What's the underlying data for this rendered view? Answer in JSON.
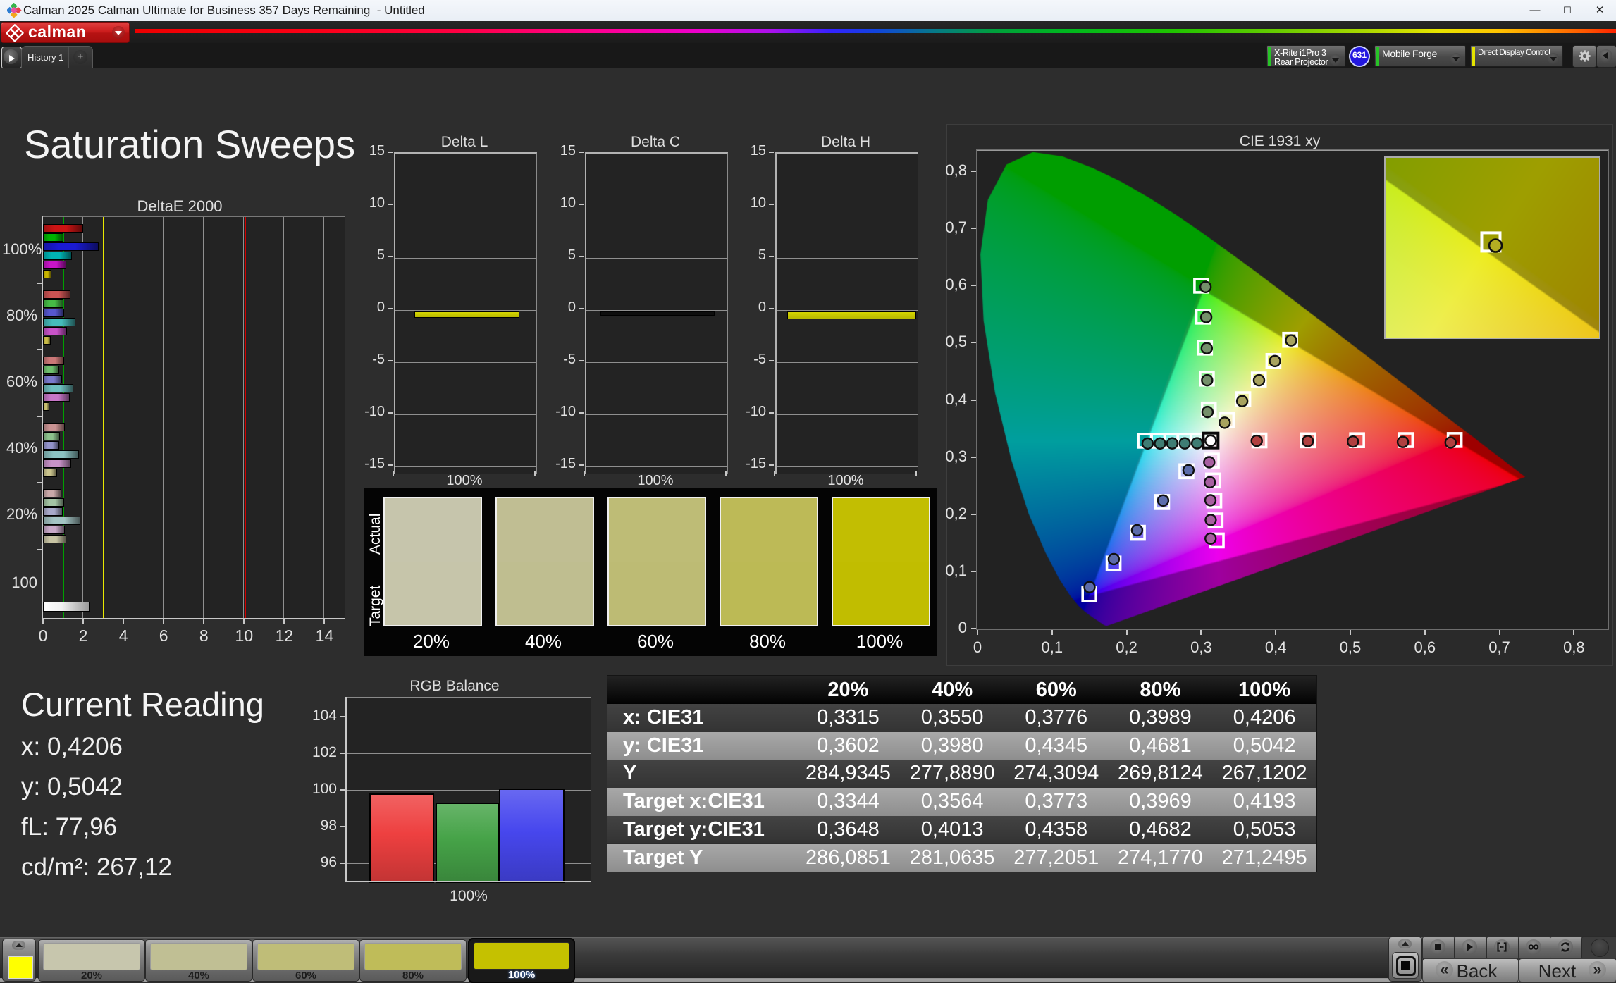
{
  "window": {
    "title": "Calman 2025 Calman Ultimate for Business 357 Days Remaining  - Untitled",
    "minimize": "—",
    "maximize": "☐",
    "close": "✕"
  },
  "logo_bar": {
    "brand": "calman",
    "brand_color": "#cc1d1d"
  },
  "tab_bar": {
    "tab": "History 1",
    "add": "+",
    "meter": {
      "line1": "X-Rite i1Pro 3",
      "line2": "Rear Projector",
      "accent": "#27c427"
    },
    "badge": "631",
    "badge_color": "#2217e0",
    "source": "Mobile Forge",
    "source_accent": "#27c427",
    "display_control": "Direct Display Control",
    "display_control_accent": "#e3e300"
  },
  "page": {
    "title": "Saturation Sweeps"
  },
  "reading": {
    "title": "Current Reading",
    "lines": [
      "x: 0,4206",
      "y: 0,5042",
      "fL: 77,96",
      "cd/m²: 267,12"
    ]
  },
  "cie": {
    "title": "CIE 1931 xy"
  },
  "chart_data": [
    {
      "id": "deltae",
      "type": "bar",
      "title": "DeltaE 2000",
      "orientation": "horizontal",
      "categories": [
        "100%",
        "80%",
        "60%",
        "40%",
        "20%",
        "100"
      ],
      "series": [
        {
          "name": "red",
          "color": "#cc1414",
          "values": [
            2.0,
            1.36,
            1.06,
            1.1,
            0.9,
            null
          ]
        },
        {
          "name": "green",
          "color": "#00b400",
          "values": [
            1.0,
            1.03,
            0.8,
            0.85,
            1.06,
            null
          ]
        },
        {
          "name": "blue",
          "color": "#1a1ad2",
          "values": [
            2.77,
            1.06,
            0.96,
            0.82,
            0.98,
            null
          ]
        },
        {
          "name": "cyan",
          "color": "#00b4b4",
          "values": [
            1.43,
            1.6,
            1.49,
            1.77,
            1.85,
            null
          ]
        },
        {
          "name": "magenta",
          "color": "#c814c8",
          "values": [
            1.14,
            1.2,
            1.34,
            1.4,
            1.1,
            null
          ]
        },
        {
          "name": "yellow",
          "color": "#c8b400",
          "values": [
            0.42,
            0.4,
            0.33,
            0.7,
            1.17,
            null
          ]
        },
        {
          "name": "white",
          "color": "#ffffff",
          "values": [
            null,
            null,
            null,
            null,
            null,
            2.32
          ]
        }
      ],
      "desaturation_by_group": [
        0,
        0.35,
        0.55,
        0.7,
        0.82,
        0
      ],
      "xlim": [
        0,
        15
      ],
      "xticks": [
        0,
        2,
        4,
        6,
        8,
        10,
        12,
        14
      ],
      "ref_lines": [
        {
          "value": 1.0,
          "color": "#00a000"
        },
        {
          "value": 3.0,
          "color": "#e8e800"
        },
        {
          "value": 10.05,
          "color": "#d40000"
        }
      ]
    },
    {
      "id": "deltaL",
      "type": "bar",
      "title": "Delta L",
      "categories": [
        "100%"
      ],
      "values": [
        -0.45
      ],
      "bar_color": "#d6d600",
      "ylim": [
        -15,
        15
      ],
      "yticks": [
        15,
        10,
        5,
        0,
        -5,
        -10,
        -15
      ],
      "bar_thickness": 9
    },
    {
      "id": "deltaC",
      "type": "bar",
      "title": "Delta C",
      "categories": [
        "100%"
      ],
      "values": [
        -0.05
      ],
      "bar_color": "#0d0d0d",
      "ylim": [
        -15,
        15
      ],
      "yticks": [
        15,
        10,
        5,
        0,
        -5,
        -10,
        -15
      ],
      "bar_thickness": 6
    },
    {
      "id": "deltaH",
      "type": "bar",
      "title": "Delta H",
      "categories": [
        "100%"
      ],
      "values": [
        -0.5
      ],
      "bar_color": "#d6d600",
      "ylim": [
        -15,
        15
      ],
      "yticks": [
        15,
        10,
        5,
        0,
        -5,
        -10,
        -15
      ],
      "bar_thickness": 11
    },
    {
      "id": "cie1931",
      "type": "scatter",
      "title": "CIE 1931 xy",
      "xlim": [
        0,
        0.845
      ],
      "ylim": [
        0,
        0.836
      ],
      "xticks": [
        "0",
        "0,1",
        "0,2",
        "0,3",
        "0,4",
        "0,5",
        "0,6",
        "0,7",
        "0,8"
      ],
      "yticks": [
        "0",
        "0,1",
        "0,2",
        "0,3",
        "0,4",
        "0,5",
        "0,6",
        "0,7",
        "0,8"
      ],
      "gamut_triangle": [
        [
          0.729,
          0.26
        ],
        [
          0.303,
          0.592
        ],
        [
          0.15,
          0.057
        ]
      ],
      "white_point": {
        "target": [
          0.3127,
          0.329
        ],
        "measured": [
          0.3127,
          0.3287
        ],
        "point_color": "#ffffff"
      },
      "series": [
        {
          "name": "red",
          "point_color": "#b04040",
          "targets": [
            [
              0.3782,
              0.3292
            ],
            [
              0.4436,
              0.3294
            ],
            [
              0.5091,
              0.3296
            ],
            [
              0.5745,
              0.3298
            ],
            [
              0.64,
              0.33
            ]
          ],
          "measured": [
            [
              0.3745,
              0.3285
            ],
            [
              0.443,
              0.328
            ],
            [
              0.5035,
              0.3272
            ],
            [
              0.5705,
              0.3265
            ],
            [
              0.6345,
              0.3255
            ]
          ]
        },
        {
          "name": "green",
          "point_color": "#74906a",
          "targets": [
            [
              0.3102,
              0.3832
            ],
            [
              0.3076,
              0.4374
            ],
            [
              0.3051,
              0.4916
            ],
            [
              0.3025,
              0.5458
            ],
            [
              0.3,
              0.6
            ]
          ],
          "measured": [
            [
              0.3085,
              0.379
            ],
            [
              0.308,
              0.4345
            ],
            [
              0.3075,
              0.4905
            ],
            [
              0.3068,
              0.545
            ],
            [
              0.3059,
              0.5977
            ]
          ]
        },
        {
          "name": "blue",
          "point_color": "#5c6cab",
          "targets": [
            [
              0.2802,
              0.2752
            ],
            [
              0.2476,
              0.2214
            ],
            [
              0.2151,
              0.1676
            ],
            [
              0.1825,
              0.1138
            ],
            [
              0.15,
              0.06
            ]
          ],
          "measured": [
            [
              0.283,
              0.277
            ],
            [
              0.249,
              0.224
            ],
            [
              0.214,
              0.172
            ],
            [
              0.1828,
              0.1215
            ],
            [
              0.1503,
              0.0725
            ]
          ]
        },
        {
          "name": "cyan",
          "point_color": "#3f7d74",
          "targets": [
            [
              0.2951,
              0.3289
            ],
            [
              0.2775,
              0.3288
            ],
            [
              0.2599,
              0.3288
            ],
            [
              0.2422,
              0.3287
            ],
            [
              0.2246,
              0.3287
            ]
          ],
          "measured": [
            [
              0.2945,
              0.3242
            ],
            [
              0.278,
              0.324
            ],
            [
              0.2612,
              0.324
            ],
            [
              0.2448,
              0.3239
            ],
            [
              0.2282,
              0.3238
            ]
          ]
        },
        {
          "name": "magenta",
          "point_color": "#a85fa0",
          "targets": [
            [
              0.3143,
              0.294
            ],
            [
              0.316,
              0.2591
            ],
            [
              0.3176,
              0.2241
            ],
            [
              0.3193,
              0.1892
            ],
            [
              0.3209,
              0.1542
            ]
          ],
          "measured": [
            [
              0.3108,
              0.291
            ],
            [
              0.3116,
              0.256
            ],
            [
              0.3124,
              0.2245
            ],
            [
              0.3128,
              0.19
            ],
            [
              0.3126,
              0.1575
            ]
          ]
        },
        {
          "name": "yellow",
          "point_color": "#a8a35e",
          "targets": [
            [
              0.3344,
              0.3648
            ],
            [
              0.3564,
              0.4013
            ],
            [
              0.3773,
              0.4358
            ],
            [
              0.3969,
              0.4682
            ],
            [
              0.4193,
              0.5053
            ]
          ],
          "measured": [
            [
              0.3315,
              0.3602
            ],
            [
              0.355,
              0.398
            ],
            [
              0.3776,
              0.4345
            ],
            [
              0.3989,
              0.4681
            ],
            [
              0.4206,
              0.5042
            ]
          ]
        }
      ],
      "inset": {
        "window": [
          0.3897,
          0.4497,
          0.476,
          0.5311
        ],
        "target": [
          0.4193,
          0.5053
        ],
        "measured": [
          0.4206,
          0.5042
        ]
      }
    },
    {
      "id": "rgbbalance",
      "type": "bar",
      "title": "RGB Balance",
      "categories": [
        "100%"
      ],
      "series": [
        {
          "name": "Red",
          "value": 99.85,
          "color": "#ee4040"
        },
        {
          "name": "Green",
          "value": 99.35,
          "color": "#46a348"
        },
        {
          "name": "Blue",
          "value": 100.1,
          "color": "#4747ee"
        }
      ],
      "ylim": [
        94.95,
        105.05
      ],
      "yticks": [
        96,
        98,
        100,
        102,
        104
      ],
      "xlabel": "100%"
    }
  ],
  "comparator": {
    "row_labels": [
      "Actual",
      "Target"
    ],
    "columns": [
      {
        "label": "20%",
        "actual": "#c6c5ac",
        "target": "#c6c5aa"
      },
      {
        "label": "40%",
        "actual": "#c0be93",
        "target": "#bfbe90"
      },
      {
        "label": "60%",
        "actual": "#bebc76",
        "target": "#bdbb74"
      },
      {
        "label": "80%",
        "actual": "#bdba57",
        "target": "#bcba55"
      },
      {
        "label": "100%",
        "actual": "#c2be02",
        "target": "#c1bd00"
      }
    ]
  },
  "table": {
    "headers": [
      "",
      "20%",
      "40%",
      "60%",
      "80%",
      "100%"
    ],
    "rows": [
      {
        "label": "x: CIE31",
        "shade": "dark",
        "values": [
          "0,3315",
          "0,3550",
          "0,3776",
          "0,3989",
          "0,4206"
        ]
      },
      {
        "label": "y: CIE31",
        "shade": "light",
        "values": [
          "0,3602",
          "0,3980",
          "0,4345",
          "0,4681",
          "0,5042"
        ]
      },
      {
        "label": "Y",
        "shade": "dark",
        "values": [
          "284,9345",
          "277,8890",
          "274,3094",
          "269,8124",
          "267,1202"
        ]
      },
      {
        "label": "Target x:CIE31",
        "shade": "light",
        "values": [
          "0,3344",
          "0,3564",
          "0,3773",
          "0,3969",
          "0,4193"
        ]
      },
      {
        "label": "Target y:CIE31",
        "shade": "dark",
        "values": [
          "0,3648",
          "0,4013",
          "0,4358",
          "0,4682",
          "0,5053"
        ]
      },
      {
        "label": "Target Y",
        "shade": "light",
        "values": [
          "286,0851",
          "281,0635",
          "277,2051",
          "274,1770",
          "271,2495"
        ]
      }
    ]
  },
  "bottom_bar": {
    "current_color": "#ffff00",
    "patterns": [
      {
        "label": "20%",
        "color": "#c7c6ad",
        "selected": false
      },
      {
        "label": "40%",
        "color": "#c0bf94",
        "selected": false
      },
      {
        "label": "60%",
        "color": "#bfbd78",
        "selected": false
      },
      {
        "label": "80%",
        "color": "#bfbc59",
        "selected": false
      },
      {
        "label": "100%",
        "color": "#c5c100",
        "selected": true
      }
    ],
    "transport": [
      "stop",
      "play",
      "bracket",
      "infinity",
      "refresh",
      "record"
    ],
    "back": "Back",
    "next": "Next"
  }
}
